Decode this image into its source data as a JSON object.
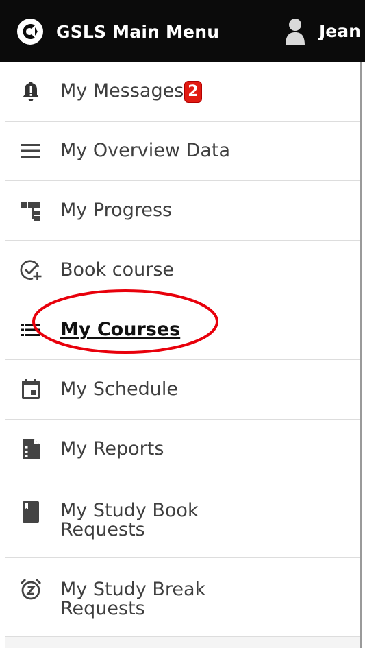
{
  "header": {
    "title": "GSLS Main Menu",
    "user_name": "Jean",
    "background": "#0b0b0b",
    "text_color": "#ffffff",
    "logo_icon": "gsls-logo-icon",
    "user_icon": "user-icon"
  },
  "menu": {
    "items": [
      {
        "label": "My Messages",
        "icon": "bell-icon",
        "badge": "2"
      },
      {
        "label": "My Overview Data",
        "icon": "list-icon"
      },
      {
        "label": "My Progress",
        "icon": "sitemap-icon"
      },
      {
        "label": "Book course",
        "icon": "check-plus-icon"
      },
      {
        "label": "My Courses",
        "icon": "list-bullets-icon",
        "active": true
      },
      {
        "label": "My Schedule",
        "icon": "calendar-icon"
      },
      {
        "label": "My Reports",
        "icon": "report-icon"
      },
      {
        "label": "My Study Book Requests",
        "icon": "book-icon"
      },
      {
        "label": "My Study Break Requests",
        "icon": "snooze-alarm-icon"
      }
    ],
    "badge_color": "#e11b12",
    "highlight_color": "#e8000b"
  }
}
